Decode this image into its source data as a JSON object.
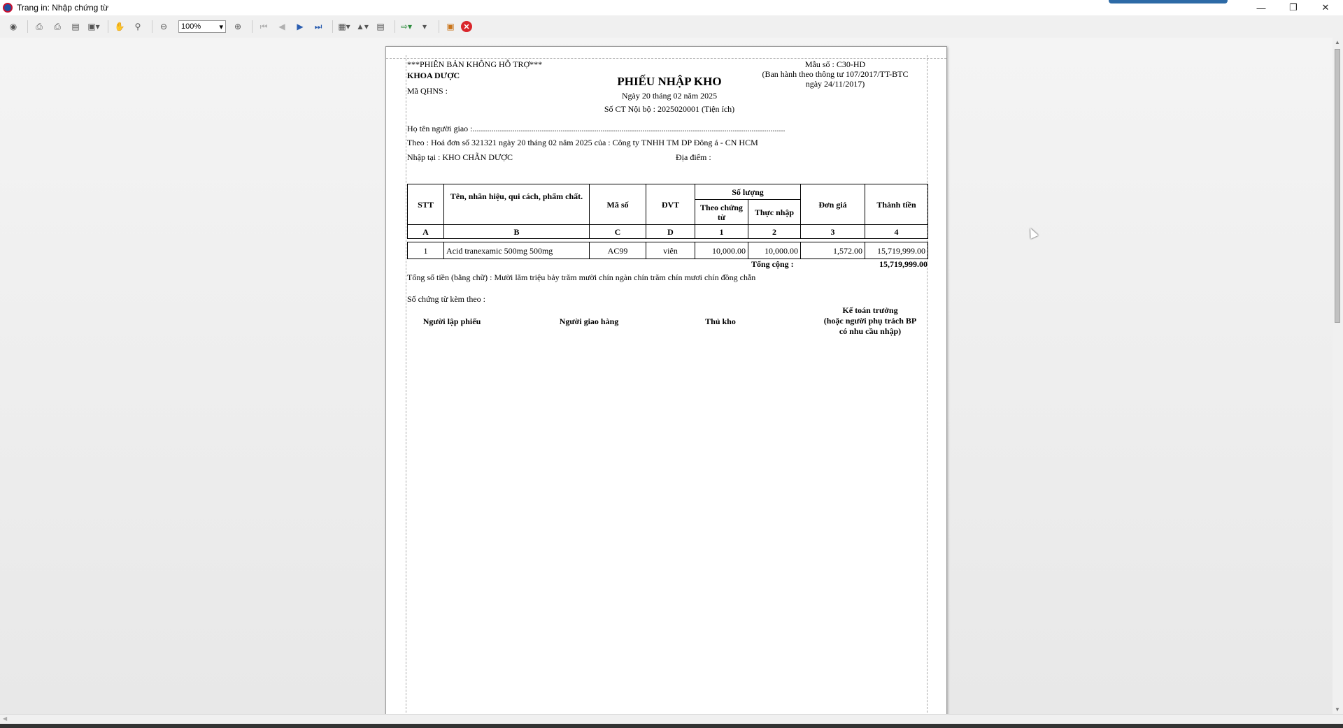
{
  "window": {
    "title": "Trang in: Nhập chứng từ"
  },
  "toolbar": {
    "zoom_value": "100%"
  },
  "report": {
    "unsupported_note": "***PHIÊN BẢN KHÔNG HỖ TRỢ***",
    "department": "KHOA DƯỢC",
    "budget_code_label": "Mã QHNS :",
    "form_code": "Mẫu số : C30-HD",
    "regulation_line1": "(Ban hành theo thông tư 107/2017/TT-BTC",
    "regulation_line2": "ngày 24/11/2017)",
    "title": "PHIẾU NHẬP KHO",
    "date_line": "Ngày 20 tháng 02 năm 2025",
    "doc_number": "Số CT Nội bộ : 2025020001 (Tiện ích)",
    "deliverer_line": "Họ tên người giao :.....................................................................................................................................................",
    "according_to": "Theo : Hoá đơn số 321321 ngày 20 tháng 02 năm 2025 của : Công ty TNHH TM DP Đông á - CN HCM",
    "import_at": "Nhập tại : KHO CHẴN DƯỢC",
    "location_label": "Địa điểm :",
    "table": {
      "h_stt": "STT",
      "h_name": "Tên, nhãn hiệu, qui cách, phẩm chất.",
      "h_code": "Mã số",
      "h_unit": "ĐVT",
      "h_quantity": "Số lượng",
      "h_qty_doc": "Theo chứng từ",
      "h_qty_actual": "Thực nhập",
      "h_price": "Đơn giá",
      "h_amount": "Thành tiền",
      "idx_a": "A",
      "idx_b": "B",
      "idx_c": "C",
      "idx_d": "D",
      "idx_1": "1",
      "idx_2": "2",
      "idx_3": "3",
      "idx_4": "4",
      "rows": [
        {
          "stt": "1",
          "name": "Acid tranexamic 500mg 500mg",
          "code": "AC99",
          "unit": "viên",
          "qty_doc": "10,000.00",
          "qty_actual": "10,000.00",
          "price": "1,572.00",
          "amount": "15,719,999.00"
        }
      ]
    },
    "total_label": "Tổng cộng :",
    "total_value": "15,719,999.00",
    "amount_words": "Tổng số tiền (bằng chữ) : Mười lăm triệu bảy trăm mười chín ngàn chín trăm chín mươi chín đồng chẵn",
    "attachments": "Số chứng từ kèm theo :",
    "sign_preparer": "Người lập phiếu",
    "sign_deliverer": "Người giao hàng",
    "sign_storekeeper": "Thủ kho",
    "sign_accountant_1": "Kế toán trưởng",
    "sign_accountant_2": "(hoặc người phụ trách BP",
    "sign_accountant_3": "có nhu cầu nhập)"
  }
}
